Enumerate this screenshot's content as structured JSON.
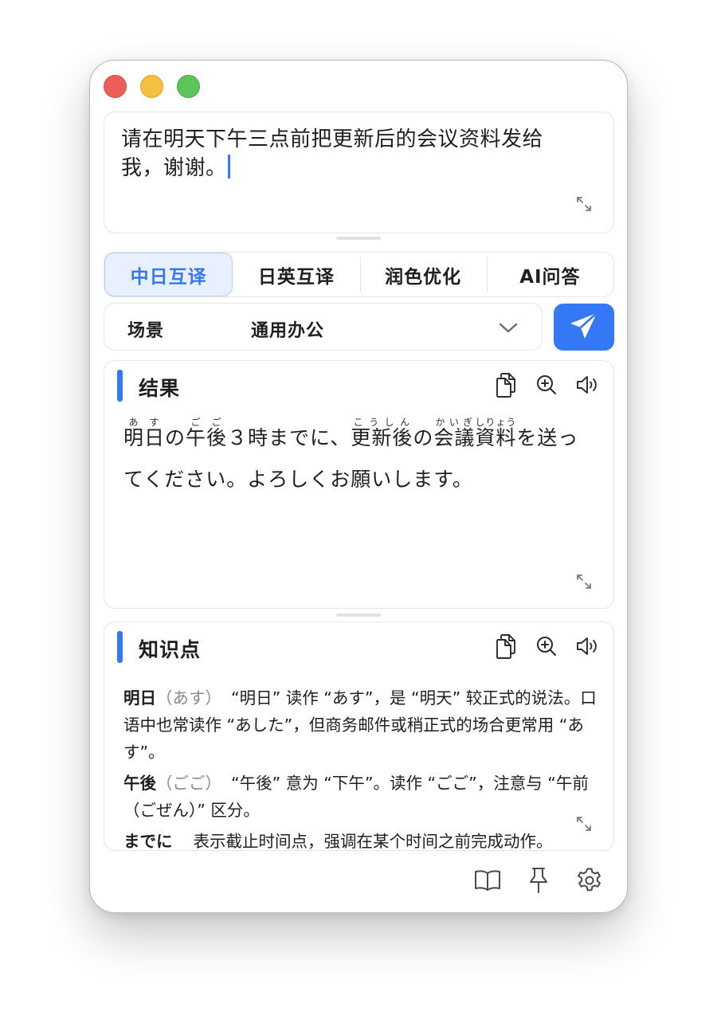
{
  "input": {
    "text": "请在明天下午三点前把更新后的会议资料发给我，谢谢。"
  },
  "modes": {
    "items": [
      {
        "label": "中日互译",
        "active": true
      },
      {
        "label": "日英互译",
        "active": false
      },
      {
        "label": "润色优化",
        "active": false
      },
      {
        "label": "AI问答",
        "active": false
      }
    ]
  },
  "scene": {
    "label": "场景",
    "value": "通用办公"
  },
  "result": {
    "title": "结果",
    "segments": {
      "asu_base": "明日",
      "asu_rt": "あす",
      "no1": "の",
      "gogo_base": "午後",
      "gogo_rt": "ごご",
      "mid1": "３時までに、",
      "koushin_base": "更新後",
      "koushin_rt": "こうしん",
      "no2": "の",
      "kaigi_base": "会議",
      "kaigi_rt": "かいぎ",
      "shiryou_base": "資料",
      "shiryou_rt": "しりょう",
      "tail": "を送ってください。よろしくお願いします。"
    }
  },
  "knowledge": {
    "title": "知识点",
    "items": [
      {
        "term": "明日",
        "reading": "（あす）",
        "desc": "“明日” 读作 “あす”，是 “明天” 较正式的说法。口语中也常读作 “あした”，但商务邮件或稍正式的场合更常用 “あす”。"
      },
      {
        "term": "午後",
        "reading": "（ごご）",
        "desc": "“午後” 意为 “下午”。读作 “ごご”，注意与 “午前（ごぜん）” 区分。"
      },
      {
        "term": "までに",
        "reading": "",
        "desc": "表示截止时间点，强调在某个时间之前完成动作。"
      }
    ]
  },
  "colors": {
    "accent": "#3478f6",
    "active_tab_bg": "#e8f0fd",
    "traffic_red": "#ee5e58",
    "traffic_yellow": "#f4c03e",
    "traffic_green": "#5cc55a"
  },
  "icons": {
    "expand": "expand-icon",
    "send": "paper-plane-icon",
    "copy": "copy-icon",
    "zoom": "zoom-in-icon",
    "speaker": "speaker-icon",
    "chevron": "chevron-down-icon",
    "book": "book-icon",
    "pin": "pin-icon",
    "settings": "gear-icon"
  }
}
